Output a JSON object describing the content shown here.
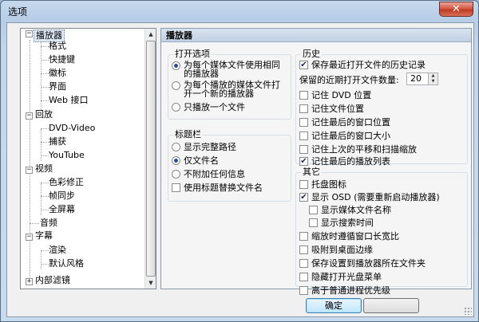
{
  "window": {
    "title": "选项",
    "close_glyph": "✕"
  },
  "tree": {
    "items": [
      {
        "label": "播放器",
        "level": 0,
        "expanded": true,
        "selected": true
      },
      {
        "label": "格式",
        "level": 1
      },
      {
        "label": "快捷键",
        "level": 1
      },
      {
        "label": "徽标",
        "level": 1
      },
      {
        "label": "界面",
        "level": 1
      },
      {
        "label": "Web 接口",
        "level": 1
      },
      {
        "label": "回放",
        "level": 0,
        "expanded": true
      },
      {
        "label": "DVD-Video",
        "level": 1
      },
      {
        "label": "捕获",
        "level": 1
      },
      {
        "label": "YouTube",
        "level": 1
      },
      {
        "label": "视频",
        "level": 0,
        "expanded": true
      },
      {
        "label": "色彩修正",
        "level": 1
      },
      {
        "label": "帧同步",
        "level": 1
      },
      {
        "label": "全屏幕",
        "level": 1
      },
      {
        "label": "音频",
        "level": 0
      },
      {
        "label": "字幕",
        "level": 0,
        "expanded": true
      },
      {
        "label": "渲染",
        "level": 1
      },
      {
        "label": "默认风格",
        "level": 1
      },
      {
        "label": "内部滤镜",
        "level": 0,
        "expanded": false
      }
    ]
  },
  "panel": {
    "title": "播放器",
    "open_options": {
      "title": "打开选项",
      "opt1_line1": "为每个媒体文件使用相同",
      "opt1_line2": "的播放器",
      "opt2_line1": "为每个播放的媒体文件打",
      "opt2_line2": "开一个新的播放器",
      "opt3": "只播放一个文件",
      "selected": 0
    },
    "title_bar": {
      "title": "标题栏",
      "opt1": "显示完整路径",
      "opt2": "仅文件名",
      "opt3": "不附加任何信息",
      "check": "使用标题替换文件名",
      "selected": 1
    },
    "history": {
      "title": "历史",
      "keep_history": "保存最近打开文件的历史记录",
      "keep_count_label": "保留的近期打开文件数量:",
      "keep_count": "20",
      "dvd_pos": "记住 DVD 位置",
      "file_pos": "记住文件位置",
      "win_pos": "记住最后的窗口位置",
      "win_size": "记住最后的窗口大小",
      "pan_scan": "记住上次的平移和扫描缩放",
      "playlist": "记住最后的播放列表"
    },
    "other": {
      "title": "其它",
      "tray": "托盘图标",
      "osd": "显示 OSD (需要重新启动播放器)",
      "osd_filename": "显示媒体文件名称",
      "osd_seektime": "显示搜索时间",
      "zoom_ratio": "缩放时遵循窗口长宽比",
      "snap": "吸附到桌面边缘",
      "save_settings": "保存设置到播放器所在文件夹",
      "hide_disc_menu": "隐藏打开光盘菜单",
      "high_priority": "高于普通进程优先级"
    }
  },
  "buttons": {
    "ok": "确定",
    "cancel": ""
  }
}
